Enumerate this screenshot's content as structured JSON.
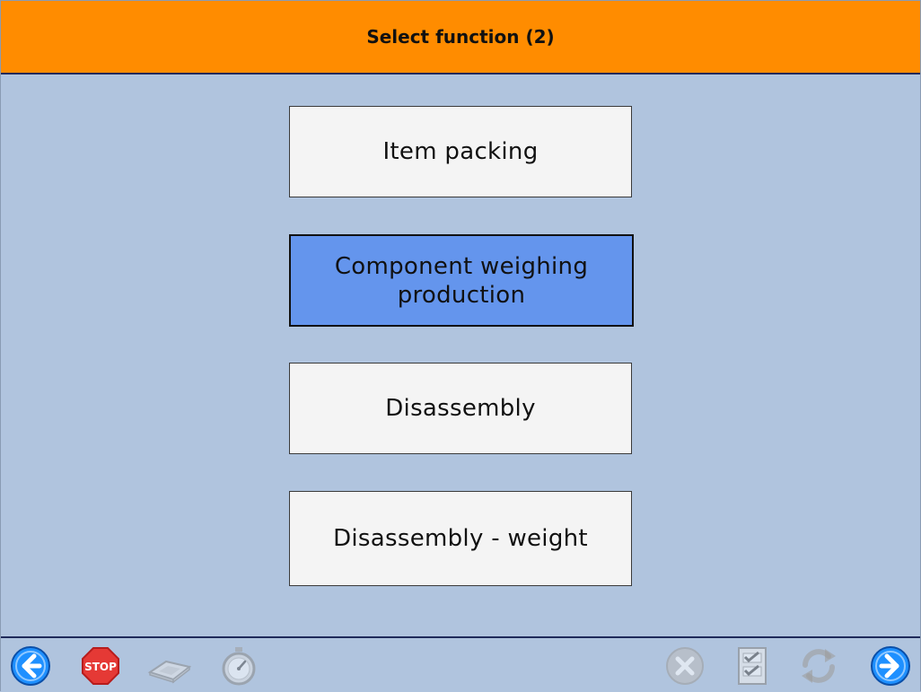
{
  "header": {
    "title": "Select function (2)"
  },
  "functions": [
    {
      "label": "Item packing",
      "selected": false
    },
    {
      "label": "Component weighing production",
      "selected": true
    },
    {
      "label": "Disassembly",
      "selected": false
    },
    {
      "label": "Disassembly - weight",
      "selected": false
    }
  ],
  "toolbar": {
    "left": [
      "back-arrow-icon",
      "stop-sign-icon",
      "scanner-icon",
      "stopwatch-icon"
    ],
    "right": [
      "cancel-icon",
      "checklist-icon",
      "refresh-icon",
      "forward-arrow-icon"
    ]
  },
  "colors": {
    "header_bg": "#ff8c00",
    "page_bg": "#b0c4de",
    "button_bg": "#f4f4f4",
    "selected_bg": "#6495ed",
    "nav_blue": "#1e90ff",
    "stop_red": "#e53935"
  }
}
